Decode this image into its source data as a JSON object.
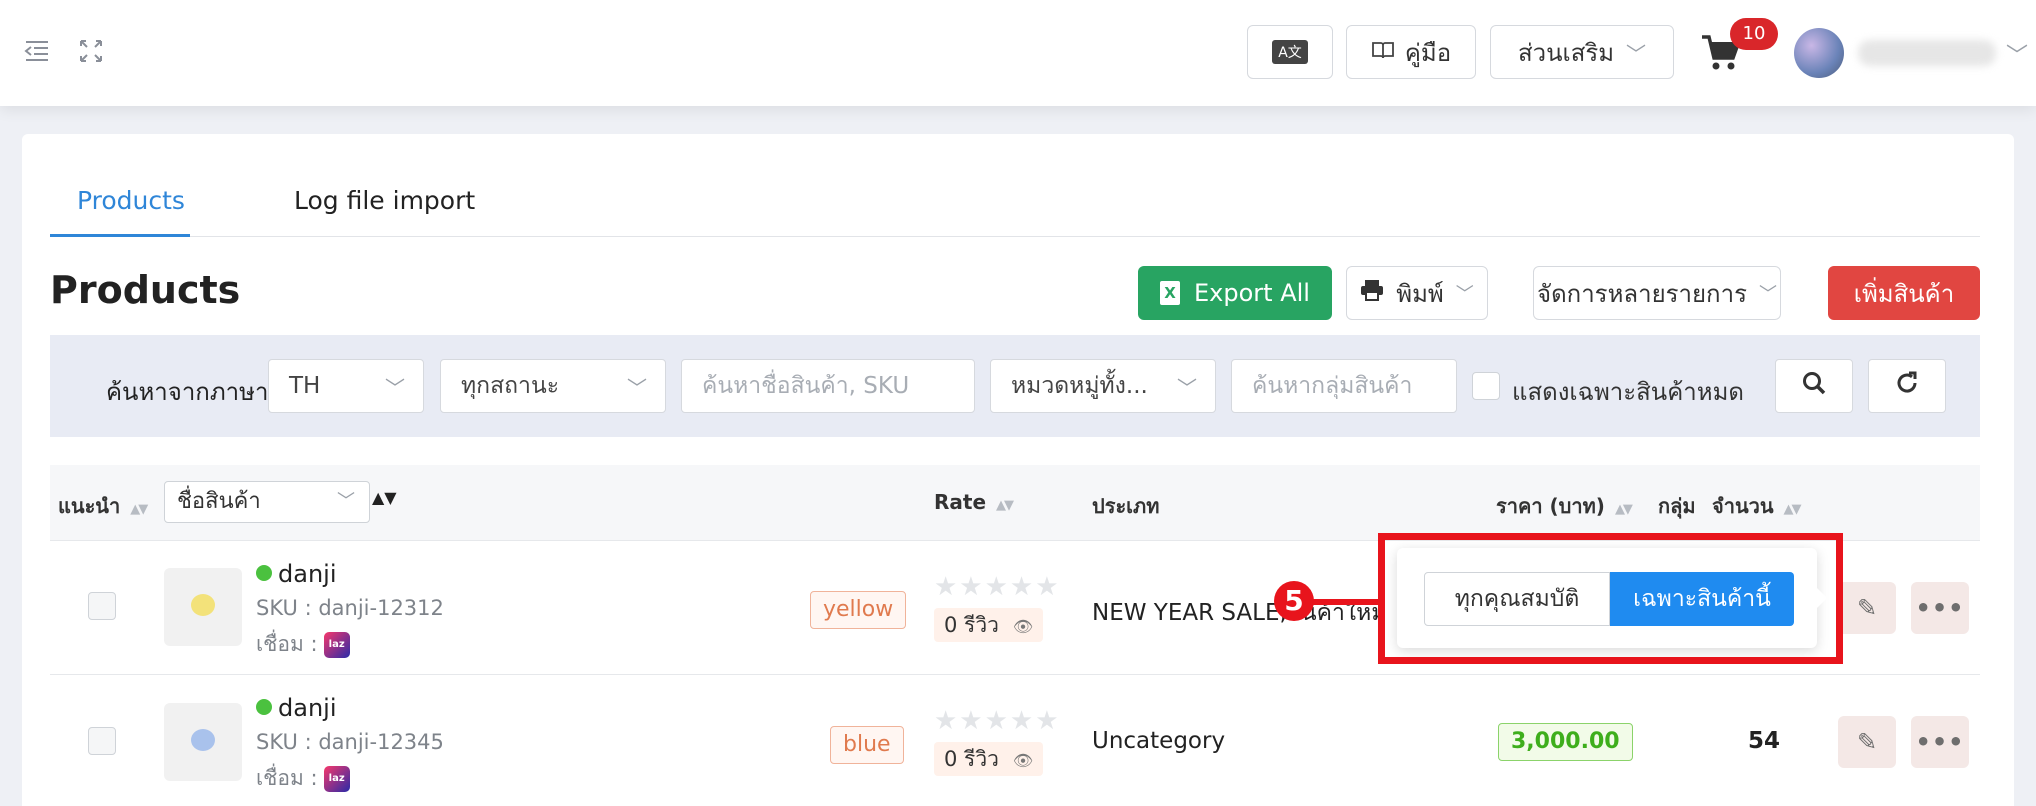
{
  "topbar": {
    "translate_label": "A文",
    "manual_label": "คู่มือ",
    "addons_label": "ส่วนเสริม",
    "cart_count": "10"
  },
  "tabs": [
    {
      "label": "Products",
      "active": true
    },
    {
      "label": "Log file import",
      "active": false
    }
  ],
  "page": {
    "title": "Products",
    "export_label": "Export All",
    "print_label": "พิมพ์",
    "bulk_label": "จัดการหลายรายการ",
    "add_label": "เพิ่มสินค้า"
  },
  "filters": {
    "lang_label": "ค้นหาจากภาษา",
    "lang_value": "TH",
    "status_value": "ทุกสถานะ",
    "search_placeholder": "ค้นหาชื่อสินค้า, SKU",
    "category_value": "หมวดหมู่ทั้ง...",
    "group_placeholder": "ค้นหากลุ่มสินค้า",
    "out_of_stock_label": "แสดงเฉพาะสินค้าหมด"
  },
  "table": {
    "col_recommend": "แนะนำ",
    "col_name": "ชื่อสินค้า",
    "col_rate": "Rate",
    "col_category": "ประเภท",
    "col_price": "ราคา (บาท)",
    "col_group": "กลุ่ม",
    "col_qty": "จำนวน",
    "rows": [
      {
        "name": "danji",
        "sku": "SKU : danji-12312",
        "linked": "เชื่อม :",
        "tag": "yellow",
        "stars": "★★★★★",
        "reviews": "0 รีวิว",
        "category": "NEW YEAR SALE,สินค้าใหม่",
        "price": "",
        "qty": ""
      },
      {
        "name": "danji",
        "sku": "SKU : danji-12345",
        "linked": "เชื่อม :",
        "tag": "blue",
        "stars": "★★★★★",
        "reviews": "0 รีวิว",
        "category": "Uncategory",
        "price": "3,000.00",
        "qty": "54"
      }
    ]
  },
  "popover": {
    "all_label": "ทุกคุณสมบัติ",
    "this_label": "เฉพาะสินค้านี้"
  },
  "annotation": {
    "number": "5",
    "color": "#e8141c"
  },
  "colors": {
    "primary": "#2f86d8",
    "green": "#28a462",
    "red": "#e14641",
    "popover_blue": "#1f8bf0"
  }
}
